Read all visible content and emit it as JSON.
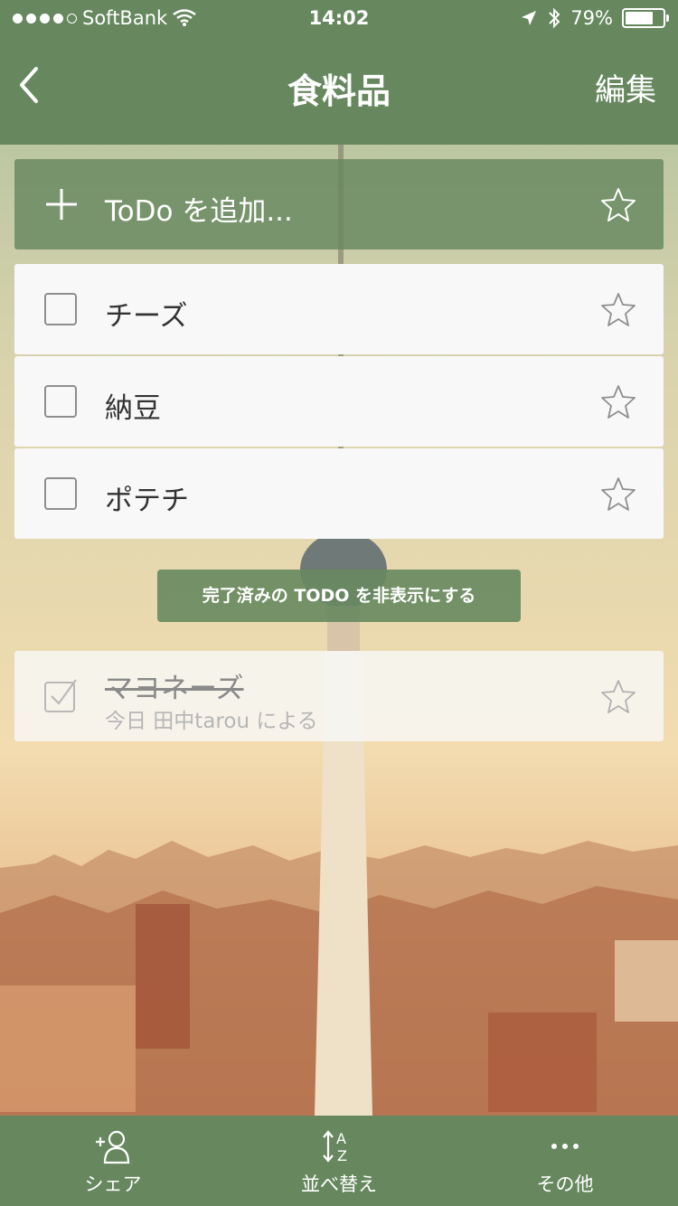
{
  "status_bar": {
    "carrier": "SoftBank",
    "time": "14:02",
    "battery": "79%",
    "battery_level": 0.79
  },
  "nav": {
    "title": "食料品",
    "edit_label": "編集"
  },
  "add_todo": {
    "label": "ToDo を追加..."
  },
  "tasks": [
    {
      "title": "チーズ"
    },
    {
      "title": "納豆"
    },
    {
      "title": "ポテチ"
    }
  ],
  "toggle_completed_label": "完了済みの TODO を非表示にする",
  "completed_tasks": [
    {
      "title": "マヨネーズ",
      "meta": "今日 田中tarou による"
    }
  ],
  "toolbar": {
    "share_label": "シェア",
    "sort_label": "並べ替え",
    "more_label": "その他"
  },
  "colors": {
    "accent": "#67885f",
    "card": "#f8f8f8"
  }
}
